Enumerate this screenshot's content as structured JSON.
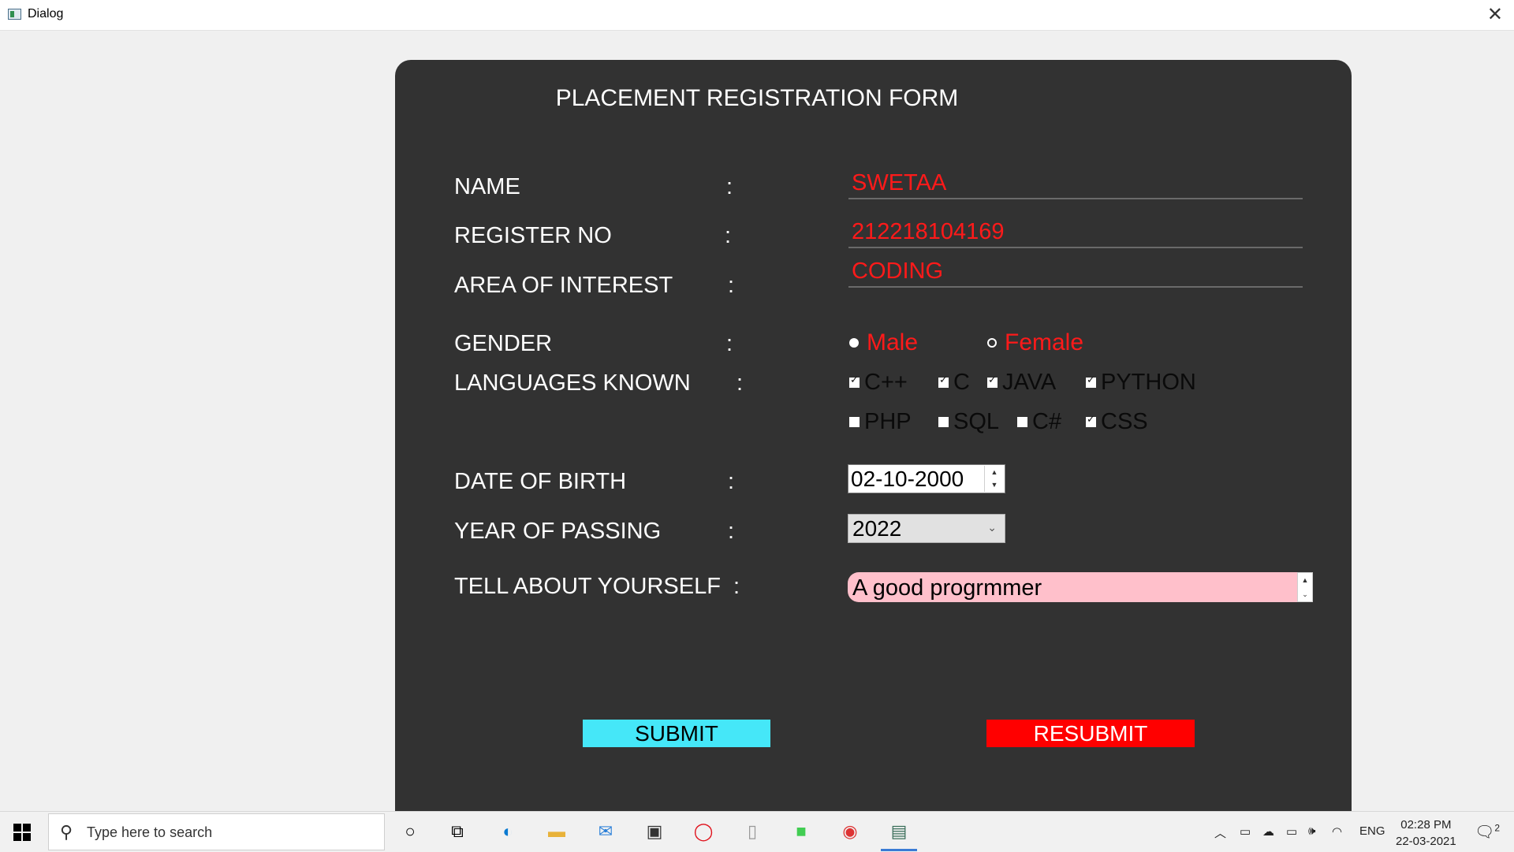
{
  "window": {
    "title": "Dialog",
    "close_glyph": "✕"
  },
  "form": {
    "title": "PLACEMENT REGISTRATION FORM",
    "colon": ":",
    "labels": {
      "name": "NAME",
      "register_no": "REGISTER NO",
      "area_of_interest": "AREA OF INTEREST",
      "gender": "GENDER",
      "languages_known": "LANGUAGES KNOWN",
      "date_of_birth": "DATE OF BIRTH",
      "year_of_passing": "YEAR OF PASSING",
      "tell_about_yourself": "TELL ABOUT YOURSELF"
    },
    "fields": {
      "name": "SWETAA",
      "register_no": "212218104169",
      "area_of_interest": "CODING"
    },
    "gender": {
      "options": [
        "Male",
        "Female"
      ],
      "selected": "Male"
    },
    "languages": [
      {
        "label": "C++",
        "checked": true
      },
      {
        "label": "C",
        "checked": true
      },
      {
        "label": "JAVA",
        "checked": true
      },
      {
        "label": "PYTHON",
        "checked": true
      },
      {
        "label": "PHP",
        "checked": false
      },
      {
        "label": "SQL",
        "checked": false
      },
      {
        "label": "C#",
        "checked": false
      },
      {
        "label": "CSS",
        "checked": true
      }
    ],
    "date_of_birth": "02-10-2000",
    "year_of_passing": "2022",
    "about": "A good progrmmer",
    "buttons": {
      "submit": "SUBMIT",
      "resubmit": "RESUBMIT"
    },
    "colors": {
      "panel": "#323232",
      "value_text": "#ff1a1a",
      "submit_bg": "#45e7f8",
      "resubmit_bg": "#ff0000",
      "about_bg": "#ffc0cb"
    }
  },
  "taskbar": {
    "search_placeholder": "Type here to search",
    "icons": [
      "windows-start-icon",
      "cortana-icon",
      "task-view-icon",
      "edge-icon",
      "file-explorer-icon",
      "mail-icon",
      "store-icon",
      "opera-icon",
      "file-icon",
      "qt-creator-icon",
      "chrome-icon",
      "dialog-app-icon"
    ],
    "tray": {
      "language": "ENG",
      "time": "02:28 PM",
      "date": "22-03-2021",
      "notification_count": "2"
    }
  }
}
